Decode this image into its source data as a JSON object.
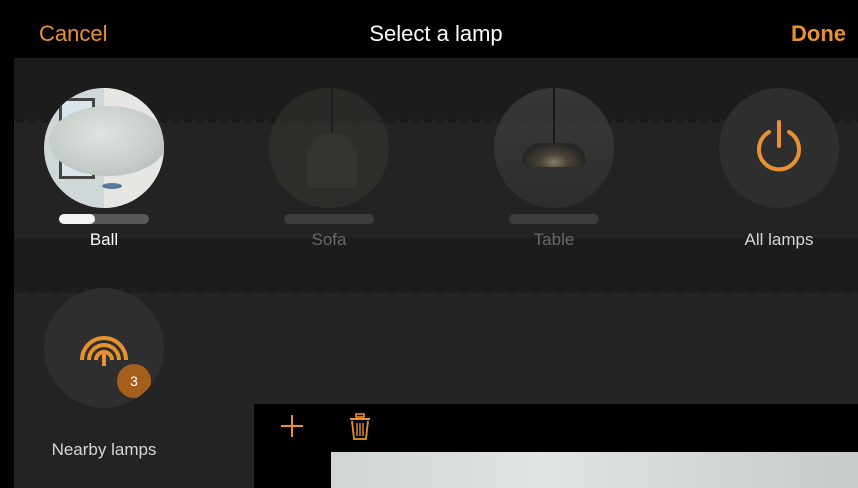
{
  "header": {
    "cancel_label": "Cancel",
    "title": "Select a lamp",
    "done_label": "Done"
  },
  "lamps": [
    {
      "label": "Ball",
      "state": "on",
      "brightness_fraction": 0.4
    },
    {
      "label": "Sofa",
      "state": "off",
      "brightness_fraction": 0
    },
    {
      "label": "Table",
      "state": "off",
      "brightness_fraction": 0
    },
    {
      "label": "All lamps",
      "icon": "power-icon"
    }
  ],
  "nearby": {
    "label": "Nearby lamps",
    "count": "3",
    "icon": "wifi-signal-icon"
  },
  "toolbar": {
    "add_icon": "plus-icon",
    "delete_icon": "trash-icon"
  },
  "colors": {
    "accent": "#e8922f",
    "background": "#232323",
    "header": "#000000",
    "badge": "#a55f1c"
  }
}
